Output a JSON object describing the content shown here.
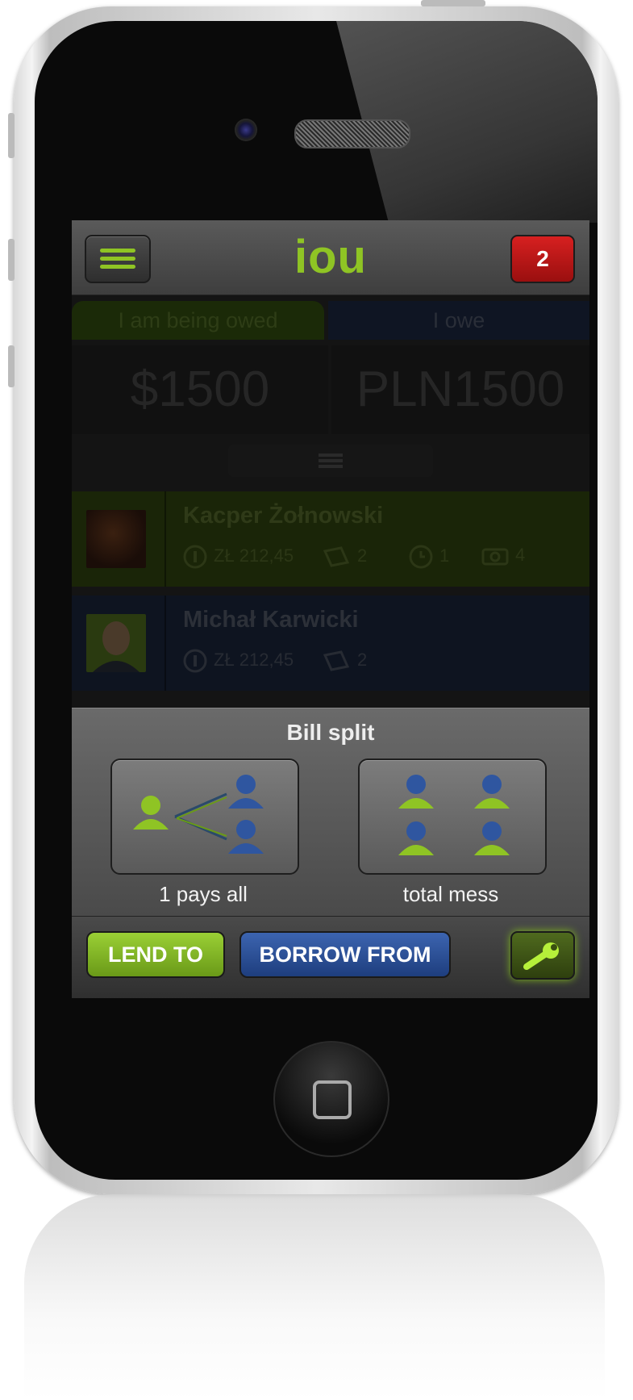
{
  "app": {
    "title": "iou",
    "notification_count": "2"
  },
  "tabs": [
    {
      "label": "I am being owed"
    },
    {
      "label": "I owe"
    }
  ],
  "totals": {
    "owed": "$1500",
    "owe": "PLN1500"
  },
  "contacts": [
    {
      "name": "Kacper Żołnowski",
      "amount": "ZŁ 212,45",
      "items": "2",
      "time": "1",
      "photos": "4"
    },
    {
      "name": "Michał Karwicki",
      "amount": "ZŁ 212,45",
      "items": "2"
    }
  ],
  "bill_split": {
    "title": "Bill split",
    "options": [
      {
        "label": "1 pays all"
      },
      {
        "label": "total mess"
      }
    ]
  },
  "toolbar": {
    "lend_label": "LEND TO",
    "borrow_label": "BORROW FROM"
  },
  "colors": {
    "accent_green": "#8fc424",
    "accent_blue": "#2f56a0",
    "alert_red": "#c81a1a"
  },
  "icons": [
    "menu-icon",
    "coin-icon",
    "book-icon",
    "clock-icon",
    "camera-icon",
    "person-icon",
    "wrench-icon"
  ]
}
